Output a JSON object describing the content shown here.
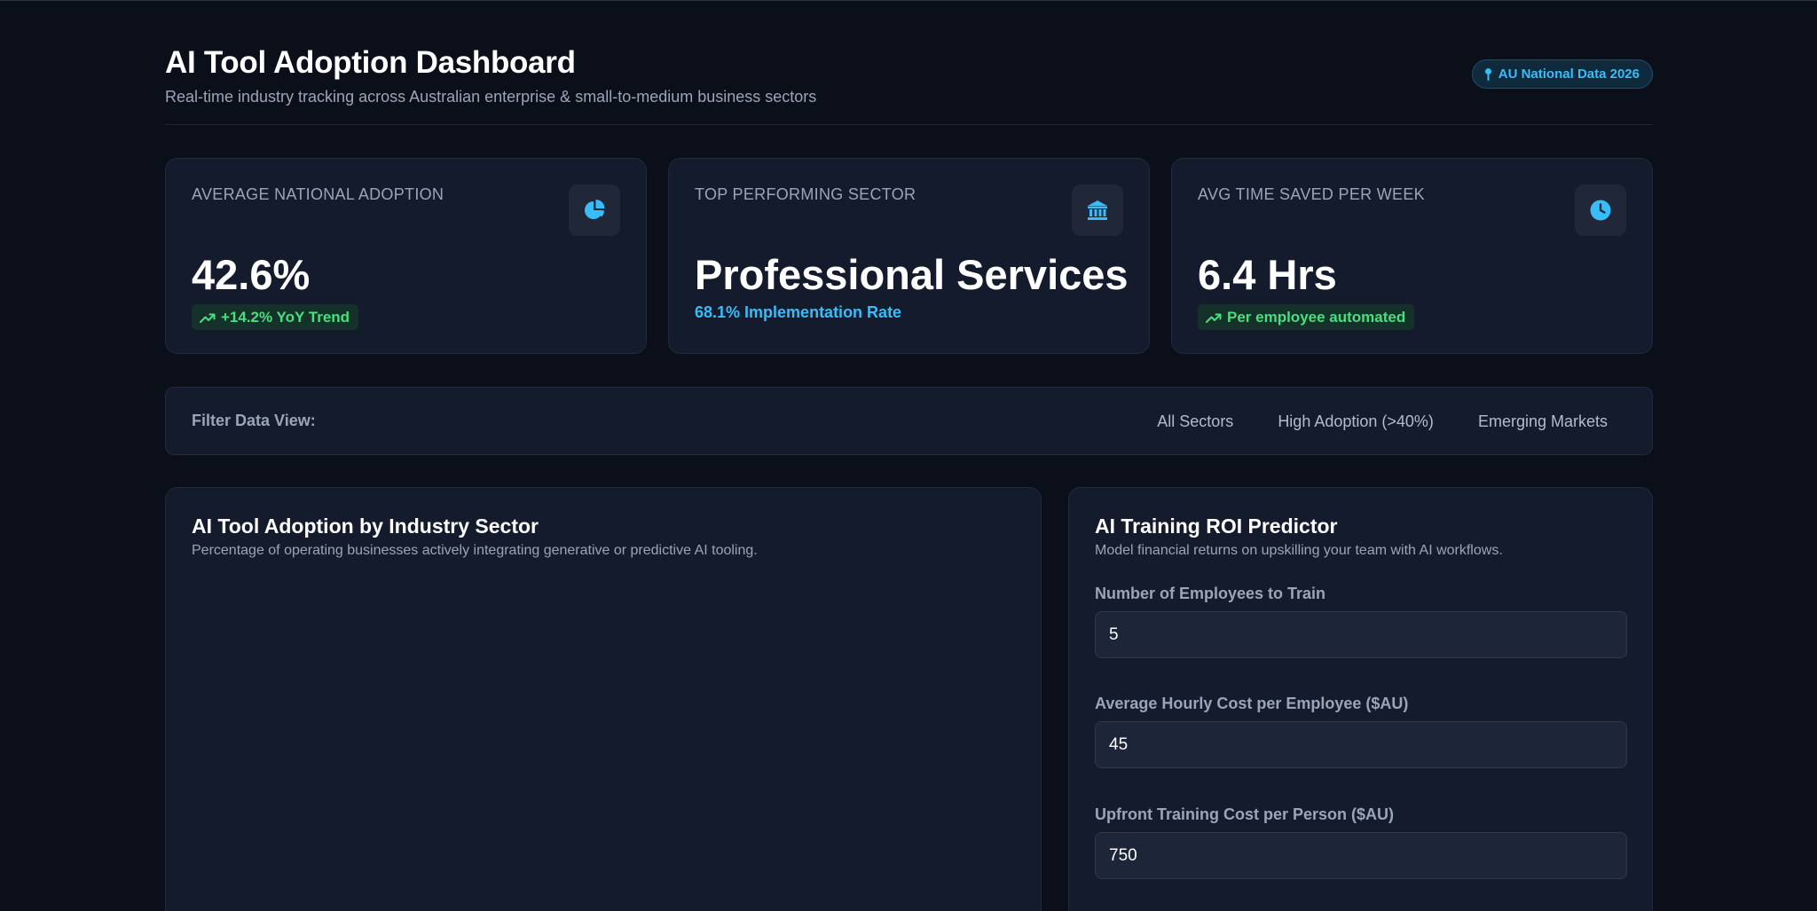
{
  "header": {
    "title": "AI Tool Adoption Dashboard",
    "subtitle": "Real-time industry tracking across Australian enterprise & small-to-medium business sectors",
    "badge": "AU National Data 2026"
  },
  "kpis": [
    {
      "label": "Average National Adoption",
      "value": "42.6%",
      "trend": "+14.2% YoY Trend",
      "icon": "pie-chart-icon"
    },
    {
      "label": "Top Performing Sector",
      "value": "Professional Services",
      "sub": "68.1% Implementation Rate",
      "icon": "bank-icon"
    },
    {
      "label": "Avg Time Saved Per Week",
      "value": "6.4 Hrs",
      "trend": "Per employee automated",
      "icon": "clock-icon"
    }
  ],
  "filter": {
    "label": "Filter Data View:",
    "options": [
      "All Sectors",
      "High Adoption (>40%)",
      "Emerging Markets"
    ]
  },
  "chart_panel": {
    "title": "AI Tool Adoption by Industry Sector",
    "description": "Percentage of operating businesses actively integrating generative or predictive AI tooling."
  },
  "roi": {
    "title": "AI Training ROI Predictor",
    "description": "Model financial returns on upskilling your team with AI workflows.",
    "fields": [
      {
        "label": "Number of Employees to Train",
        "value": "5"
      },
      {
        "label": "Average Hourly Cost per Employee ($AU)",
        "value": "45"
      },
      {
        "label": "Upfront Training Cost per Person ($AU)",
        "value": "750"
      }
    ]
  },
  "colors": {
    "accent": "#38bdf8",
    "positive": "#4ade80",
    "background": "#0b0f19",
    "card": "#141b2d"
  }
}
